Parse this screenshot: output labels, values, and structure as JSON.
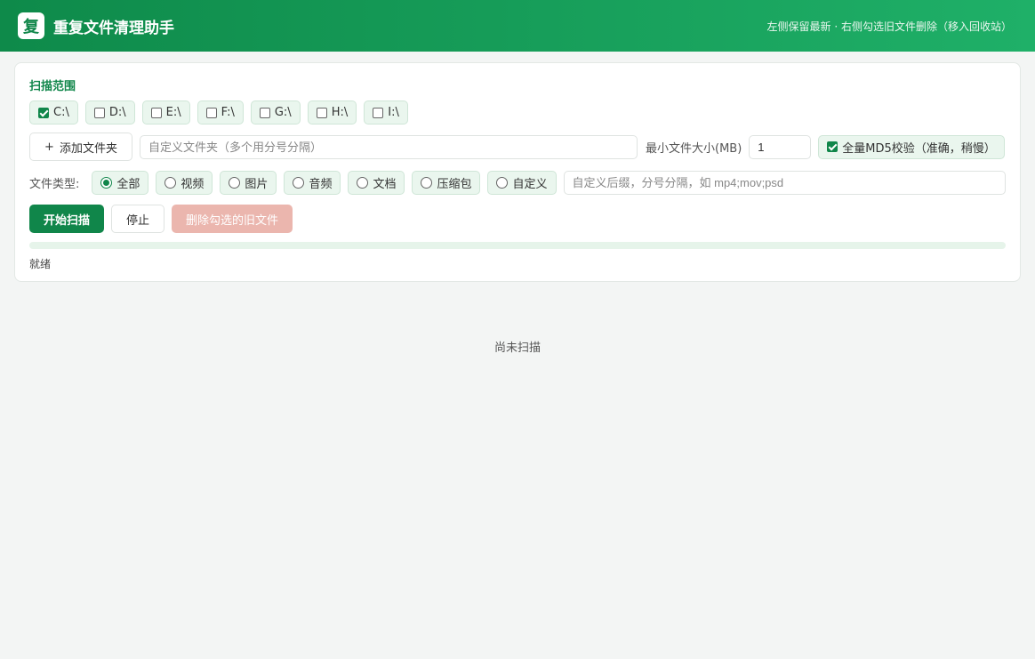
{
  "header": {
    "logo_text": "复",
    "title": "重复文件清理助手",
    "hint": "左侧保留最新 · 右侧勾选旧文件删除（移入回收站）"
  },
  "scan": {
    "title": "扫描范围",
    "drives": [
      {
        "label": "C:\\",
        "checked": true
      },
      {
        "label": "D:\\",
        "checked": false
      },
      {
        "label": "E:\\",
        "checked": false
      },
      {
        "label": "F:\\",
        "checked": false
      },
      {
        "label": "G:\\",
        "checked": false
      },
      {
        "label": "H:\\",
        "checked": false
      },
      {
        "label": "I:\\",
        "checked": false
      }
    ],
    "add_folder_label": "添加文件夹",
    "add_icon": "+",
    "folder_placeholder": "自定义文件夹（多个用分号分隔）",
    "min_size_label": "最小文件大小(MB)",
    "min_size_value": "1",
    "md5_label": "全量MD5校验（准确，稍慢）",
    "md5_checked": true
  },
  "types": {
    "label": "文件类型:",
    "options": [
      {
        "label": "全部",
        "selected": true
      },
      {
        "label": "视频",
        "selected": false
      },
      {
        "label": "图片",
        "selected": false
      },
      {
        "label": "音频",
        "selected": false
      },
      {
        "label": "文档",
        "selected": false
      },
      {
        "label": "压缩包",
        "selected": false
      },
      {
        "label": "自定义",
        "selected": false
      }
    ],
    "ext_placeholder": "自定义后缀，分号分隔，如 mp4;mov;psd"
  },
  "actions": {
    "start": "开始扫描",
    "stop": "停止",
    "delete": "删除勾选的旧文件"
  },
  "progress": 0,
  "status": "就绪",
  "results": {
    "empty_text": "尚未扫描"
  },
  "colors": {
    "accent": "#10864a",
    "danger_disabled": "#ebb6ae"
  }
}
